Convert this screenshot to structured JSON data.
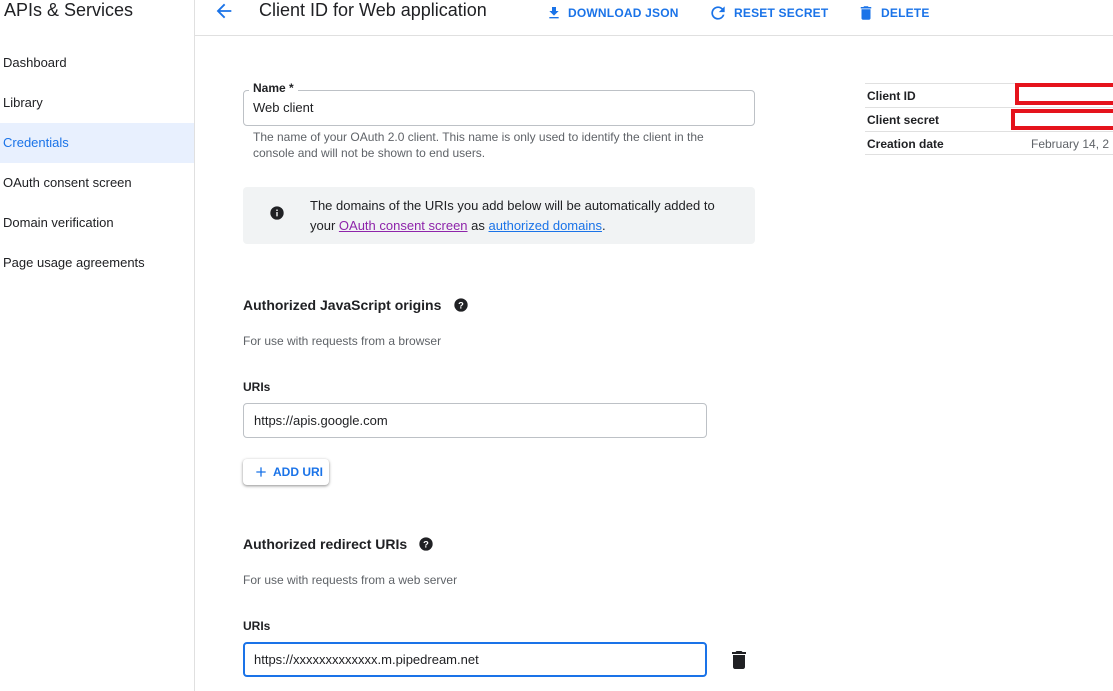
{
  "app": {
    "title": "APIs & Services"
  },
  "sidebar": {
    "items": [
      {
        "label": "Dashboard"
      },
      {
        "label": "Library"
      },
      {
        "label": "Credentials"
      },
      {
        "label": "OAuth consent screen"
      },
      {
        "label": "Domain verification"
      },
      {
        "label": "Page usage agreements"
      }
    ],
    "active": "Credentials"
  },
  "header": {
    "title": "Client ID for Web application",
    "actions": {
      "download": "DOWNLOAD JSON",
      "reset": "RESET SECRET",
      "delete": "DELETE"
    }
  },
  "form": {
    "name_label": "Name *",
    "name_value": "Web client",
    "name_help": "The name of your OAuth 2.0 client. This name is only used to identify the client in the console and will not be shown to end users.",
    "info": {
      "prefix": "The domains of the URIs you add below will be automatically added to your ",
      "link1": "OAuth consent screen",
      "middle": " as ",
      "link2": "authorized domains",
      "suffix": "."
    },
    "js_origins": {
      "title": "Authorized JavaScript origins",
      "subtitle": "For use with requests from a browser",
      "uris_label": "URIs",
      "uri_value": "https://apis.google.com",
      "add_button": "ADD URI"
    },
    "redirect": {
      "title": "Authorized redirect URIs",
      "subtitle": "For use with requests from a web server",
      "uris_label": "URIs",
      "uri_value": "https://xxxxxxxxxxxxx.m.pipedream.net"
    }
  },
  "details": {
    "client_id_label": "Client ID",
    "client_secret_label": "Client secret",
    "creation_date_label": "Creation date",
    "creation_date_value": "February 14, 2"
  },
  "colors": {
    "accent": "#1a73e8",
    "redaction": "#e5131c",
    "active_nav_bg": "#e8f0fe",
    "visited_link": "#8e24aa"
  },
  "icons": [
    "back-arrow-icon",
    "download-icon",
    "refresh-icon",
    "trash-icon",
    "info-icon",
    "help-icon",
    "plus-icon"
  ]
}
